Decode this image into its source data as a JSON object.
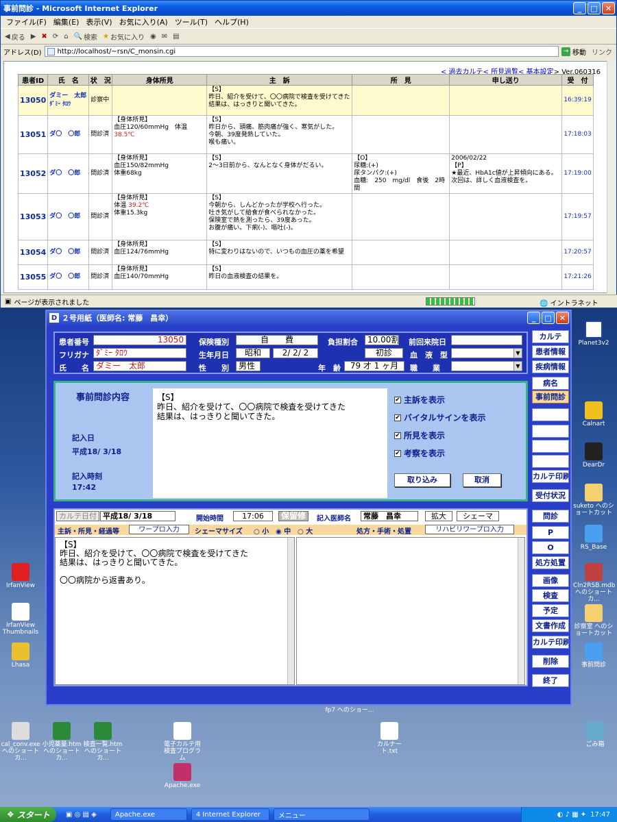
{
  "ie": {
    "title": "事前問診 - Microsoft Internet Explorer",
    "menu": [
      "ファイル(F)",
      "編集(E)",
      "表示(V)",
      "お気に入り(A)",
      "ツール(T)",
      "ヘルプ(H)"
    ],
    "toolbar": {
      "back": "戻る",
      "search": "検索",
      "favorites": "お気に入り"
    },
    "address_label": "アドレス(D)",
    "address": "http://localhost/~rsn/C_monsin.cgi",
    "go_label": "移動",
    "links_label": "リンク",
    "status": "ページが表示されました",
    "zone": "イントラネット"
  },
  "nav_links": {
    "past_karte": "< 過去カルテ",
    "findings": "< 所見過覧",
    "settings": "< 基本設定",
    "version": "> Ver.060316"
  },
  "table": {
    "headers": [
      "患者ID",
      "氏　名",
      "状　況",
      "身体所見",
      "主　訴",
      "所　見",
      "申し送り",
      "受　付"
    ],
    "rows": [
      {
        "id": "13050",
        "name": "ダミー　太郎",
        "kana": "ﾀﾞﾐｰ ﾀﾛｳ",
        "status": "診察中",
        "vitals": "",
        "vitals_red": "",
        "vitals2": "",
        "complaint": "【S】\n昨日、紹介を受けて、〇〇病院で検査を受けてきた\n結果は、はっきりと聞いてきた。",
        "findings": "",
        "note": "",
        "time": "16:39:19"
      },
      {
        "id": "13051",
        "name": "ダ〇　〇郎",
        "kana": "",
        "status": "問診済",
        "vitals": "【身体所見】\n血圧120/60mmHg　体温 ",
        "vitals_red": "38.5℃",
        "vitals2": "",
        "complaint": "【S】\n昨日から、頭痛、筋肉痛が強く、寒気がした。\n今朝、39度発熱していた。\n喉も痛い。",
        "findings": "",
        "note": "",
        "time": "17:18:03"
      },
      {
        "id": "13052",
        "name": "ダ〇　〇郎",
        "kana": "",
        "status": "問診済",
        "vitals": "【身体所見】\n血圧150/82mmHg\n体重68kg",
        "vitals_red": "",
        "vitals2": "",
        "complaint": "【S】\n2～3日前から、なんとなく身体がだるい。",
        "findings": "【O】\n尿糖:(+)\n尿タンパク:(+)\n血糖:　250　mg/dl　食後　2時間",
        "note": "2006/02/22\n【P】\n★最近、HbA1c値が上昇傾向にある。\n次回は、詳しく血液検査を。",
        "time": "17:19:00"
      },
      {
        "id": "13053",
        "name": "ダ〇　〇郎",
        "kana": "",
        "status": "問診済",
        "vitals": "【身体所見】\n体温 ",
        "vitals_red": "39.2℃",
        "vitals2": "\n体重15.3kg",
        "complaint": "【S】\n今朝から、しんどかったが学校へ行った。\n吐き気がして給食が食べられなかった。\n保険室で熱を測ったら、39度あった。\nお腹が痛い。下痢(-)、嘔吐(-)。",
        "findings": "",
        "note": "",
        "time": "17:19:57"
      },
      {
        "id": "13054",
        "name": "ダ〇　〇郎",
        "kana": "",
        "status": "問診済",
        "vitals": "【身体所見】\n血圧124/76mmHg",
        "vitals_red": "",
        "vitals2": "",
        "complaint": "【S】\n特に変わりはないので、いつもの血圧の薬を希望",
        "findings": "",
        "note": "",
        "time": "17:20:57"
      },
      {
        "id": "13055",
        "name": "ダ〇　〇郎",
        "kana": "",
        "status": "問診済",
        "vitals": "【身体所見】\n血圧140/70mmHg",
        "vitals_red": "",
        "vitals2": "",
        "complaint": "【S】\n昨日の血液検査の結果を。",
        "findings": "",
        "note": "",
        "time": "17:21:26"
      }
    ]
  },
  "app": {
    "title": "２号用紙（医師名: 常藤　昌幸）",
    "labels": {
      "patient_no": "患者番号",
      "kana": "フリガナ",
      "name": "氏　　名",
      "insurance": "保険種別",
      "birth": "生年月日",
      "sex": "性　　別",
      "burden": "負担割合",
      "last_visit": "前回来院日",
      "blood": "血　液　型",
      "job": "職　　業",
      "age": "年　齢"
    },
    "values": {
      "patient_no": "13050",
      "kana": "ﾀﾞﾐｰ ﾀﾛｳ",
      "name": "ダミー　太郎",
      "insurance": "自　　費",
      "era": "昭和",
      "birth": "2/ 2/ 2",
      "sex": "男性",
      "burden": "10.00割",
      "visit_type": "初診",
      "age": "79 才 1 ヶ月",
      "last_visit": "",
      "blood": "",
      "job": ""
    },
    "pre_title": "事前問診内容",
    "pre_text": "【S】\n昨日、紹介を受けて、〇〇病院で検査を受けてきた\n結果は、はっきりと聞いてきた。",
    "date_label": "記入日",
    "date_value": "平成18/ 3/18",
    "time_label": "記入時刻",
    "time_value": "17:42",
    "checks": [
      "主訴を表示",
      "バイタルサインを表示",
      "所見を表示",
      "考察を表示"
    ],
    "btn_import": "取り込み",
    "btn_cancel": "取消",
    "side": [
      "カルテ",
      "患者情報",
      "疾病情報",
      "病名",
      "事前問診",
      "",
      "",
      "",
      "",
      "カルテ印刷",
      "受付状況",
      "問診",
      "P",
      "O",
      "処方処置",
      "画像",
      "検査",
      "予定",
      "文書作成",
      "カルテ印刷",
      "削除",
      "終了"
    ],
    "karte": {
      "date_label": "カルテ日付",
      "date": "平成18/ 3/18",
      "start_label": "開始時間",
      "start": "17:06",
      "hold": "保留修",
      "doctor_label": "記入医師名",
      "doctor": "常藤　昌幸",
      "zoom": "拡大",
      "schema": "シェーマ",
      "left_head": "主訴・所見・経過等",
      "wp": "ワープロ入力",
      "schema_size": "シェーマサイズ",
      "small": "小",
      "medium": "中",
      "large": "大",
      "right_head": "処方・手術・処置",
      "rehab": "リハビリワープロ入力",
      "text": "【S】\n昨日、紹介を受けて、〇〇病院で検査を受けてきた\n結果は、はっきりと聞いてきた。\n\n〇〇病院から返書あり。"
    }
  },
  "desktop_icons": [
    "Planet3v2",
    "Calnart",
    "DearDr",
    "suketo へのショートカット",
    "RS_Base",
    "Cln2RSB.mdb へのショートカ...",
    "診察室 へのショートカット",
    "事前問診",
    "IrfanView",
    "IrfanView Thumbnails",
    "Lhasa",
    "cal_conv.exe へのショートカ...",
    "小児薬量.htm へのショートカ...",
    "検査一覧.htm へのショートカ...",
    "電子カルテ用 検査プログラム",
    "Apache.exe",
    "カルナート.txt",
    "ごみ箱",
    "fp7 へのショー..."
  ],
  "taskbar": {
    "start": "スタート",
    "tasks": [
      "Apache.exe",
      "4 Internet Explorer",
      "メニュー"
    ],
    "clock": "17:47"
  }
}
